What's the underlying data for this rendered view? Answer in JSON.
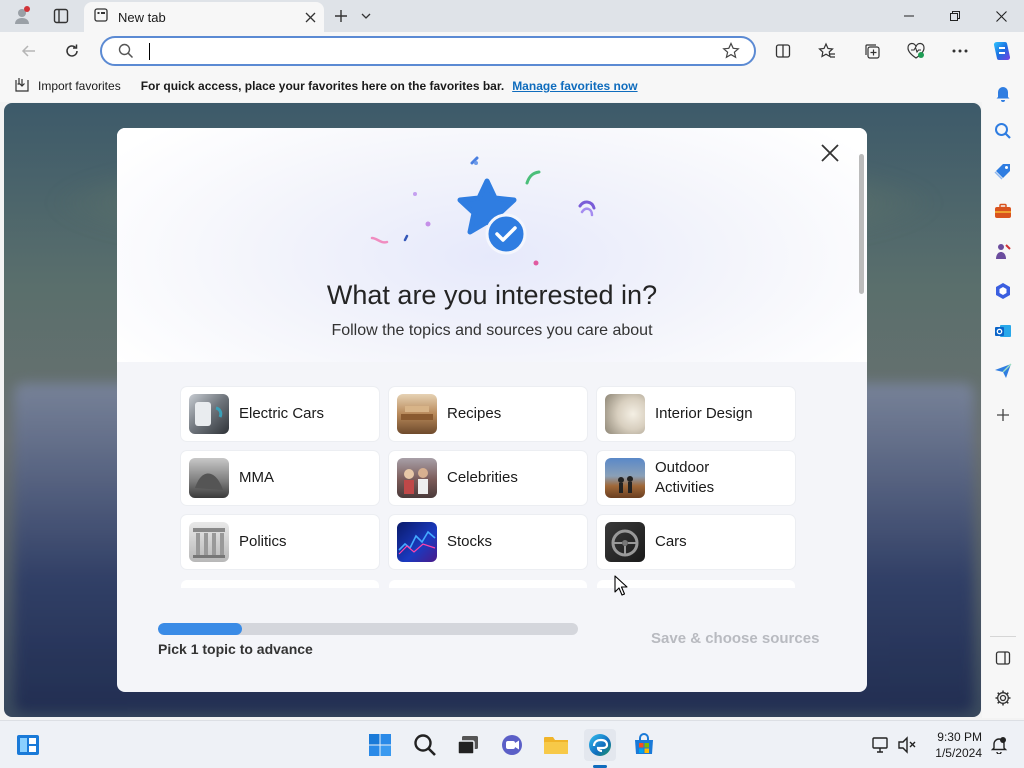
{
  "browser": {
    "tab": {
      "title": "New tab"
    },
    "address": {
      "value": "",
      "placeholder": ""
    }
  },
  "favorites_bar": {
    "import_label": "Import favorites",
    "hint": "For quick access, place your favorites here on the favorites bar.",
    "manage_link": "Manage favorites now"
  },
  "modal": {
    "title": "What are you interested in?",
    "subtitle": "Follow the topics and sources you care about",
    "topics": [
      {
        "label": "Electric Cars"
      },
      {
        "label": "Recipes"
      },
      {
        "label": "Interior Design"
      },
      {
        "label": "MMA"
      },
      {
        "label": "Celebrities"
      },
      {
        "label": "Outdoor Activities"
      },
      {
        "label": "Politics"
      },
      {
        "label": "Stocks"
      },
      {
        "label": "Cars"
      }
    ],
    "progress_fraction": 0.2,
    "progress_text": "Pick 1 topic to advance",
    "save_label": "Save & choose sources"
  },
  "taskbar": {
    "time": "9:30 PM",
    "date": "1/5/2024"
  },
  "colors": {
    "accent": "#0f6cbd",
    "progress": "#3a8be6",
    "star": "#2f7de1"
  }
}
